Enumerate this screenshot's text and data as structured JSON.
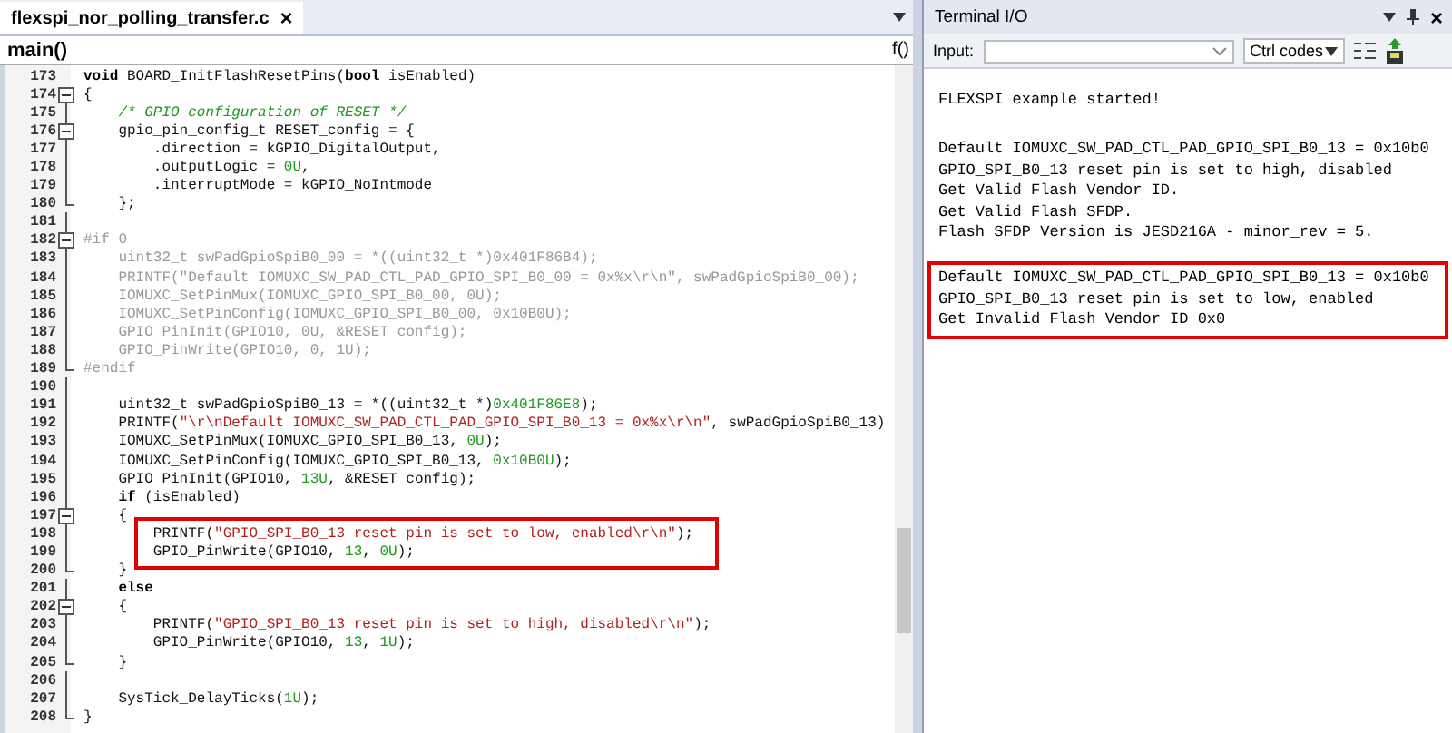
{
  "editor": {
    "tab": {
      "label": "flexspi_nor_polling_transfer.c",
      "close": "×",
      "selected": true
    },
    "function_bar": {
      "label": "main()",
      "button": "f()"
    },
    "lines": [
      {
        "number": "173",
        "kind": "none",
        "highlighted": false,
        "segments": [
          {
            "kind": "keyword",
            "text": "void"
          },
          {
            "kind": "plain",
            "text": " BOARD_InitFlashResetPins("
          },
          {
            "kind": "keyword",
            "text": "bool"
          },
          {
            "kind": "plain",
            "text": " isEnabled)"
          }
        ]
      },
      {
        "number": "174",
        "kind": "open",
        "highlighted": false,
        "segments": [
          {
            "kind": "plain",
            "text": "{"
          }
        ]
      },
      {
        "number": "175",
        "kind": "bar",
        "highlighted": false,
        "segments": [
          {
            "kind": "comment",
            "text": "    /* GPIO configuration of RESET */"
          }
        ]
      },
      {
        "number": "176",
        "kind": "open",
        "highlighted": false,
        "segments": [
          {
            "kind": "plain",
            "text": "    gpio_pin_config_t RESET_config = {"
          }
        ]
      },
      {
        "number": "177",
        "kind": "bar",
        "highlighted": false,
        "segments": [
          {
            "kind": "plain",
            "text": "        .direction = kGPIO_DigitalOutput,"
          }
        ]
      },
      {
        "number": "178",
        "kind": "bar",
        "highlighted": false,
        "segments": [
          {
            "kind": "plain",
            "text": "        .outputLogic = "
          },
          {
            "kind": "number",
            "text": "0U"
          },
          {
            "kind": "plain",
            "text": ","
          }
        ]
      },
      {
        "number": "179",
        "kind": "bar",
        "highlighted": false,
        "segments": [
          {
            "kind": "plain",
            "text": "        .interruptMode = kGPIO_NoIntmode"
          }
        ]
      },
      {
        "number": "180",
        "kind": "end",
        "highlighted": false,
        "segments": [
          {
            "kind": "plain",
            "text": "    };"
          }
        ]
      },
      {
        "number": "181",
        "kind": "bar",
        "highlighted": false
      },
      {
        "number": "182",
        "kind": "open",
        "highlighted": false,
        "segments": [
          {
            "kind": "inactive",
            "text": "#if 0"
          }
        ]
      },
      {
        "number": "183",
        "kind": "bar",
        "highlighted": false,
        "segments": [
          {
            "kind": "inactive",
            "text": "    uint32_t swPadGpioSpiB0_00 = *((uint32_t *)0x401F86B4);"
          }
        ]
      },
      {
        "number": "184",
        "kind": "bar",
        "highlighted": false,
        "segments": [
          {
            "kind": "inactive",
            "text": "    PRINTF(\"Default IOMUXC_SW_PAD_CTL_PAD_GPIO_SPI_B0_00 = 0x%x\\r\\n\", swPadGpioSpiB0_00);"
          }
        ]
      },
      {
        "number": "185",
        "kind": "bar",
        "highlighted": false,
        "segments": [
          {
            "kind": "inactive",
            "text": "    IOMUXC_SetPinMux(IOMUXC_GPIO_SPI_B0_00, 0U);"
          }
        ]
      },
      {
        "number": "186",
        "kind": "bar",
        "highlighted": false,
        "segments": [
          {
            "kind": "inactive",
            "text": "    IOMUXC_SetPinConfig(IOMUXC_GPIO_SPI_B0_00, 0x10B0U);"
          }
        ]
      },
      {
        "number": "187",
        "kind": "bar",
        "highlighted": false,
        "segments": [
          {
            "kind": "inactive",
            "text": "    GPIO_PinInit(GPIO10, 0U, &RESET_config);"
          }
        ]
      },
      {
        "number": "188",
        "kind": "bar",
        "highlighted": false,
        "segments": [
          {
            "kind": "inactive",
            "text": "    GPIO_PinWrite(GPIO10, 0, 1U);"
          }
        ]
      },
      {
        "number": "189",
        "kind": "end",
        "highlighted": false,
        "segments": [
          {
            "kind": "inactive",
            "text": "#endif"
          }
        ]
      },
      {
        "number": "190",
        "kind": "bar",
        "highlighted": false
      },
      {
        "number": "191",
        "kind": "bar",
        "highlighted": false,
        "segments": [
          {
            "kind": "plain",
            "text": "    uint32_t swPadGpioSpiB0_13 = *((uint32_t *)"
          },
          {
            "kind": "number",
            "text": "0x401F86E8"
          },
          {
            "kind": "plain",
            "text": ");"
          }
        ]
      },
      {
        "number": "192",
        "kind": "bar",
        "highlighted": false,
        "segments": [
          {
            "kind": "plain",
            "text": "    PRINTF("
          },
          {
            "kind": "string",
            "text": "\"\\r\\nDefault IOMUXC_SW_PAD_CTL_PAD_GPIO_SPI_B0_13 = 0x%x\\r\\n\""
          },
          {
            "kind": "plain",
            "text": ", swPadGpioSpiB0_13)"
          }
        ]
      },
      {
        "number": "193",
        "kind": "bar",
        "highlighted": false,
        "segments": [
          {
            "kind": "plain",
            "text": "    IOMUXC_SetPinMux(IOMUXC_GPIO_SPI_B0_13, "
          },
          {
            "kind": "number",
            "text": "0U"
          },
          {
            "kind": "plain",
            "text": ");"
          }
        ]
      },
      {
        "number": "194",
        "kind": "bar",
        "highlighted": false,
        "segments": [
          {
            "kind": "plain",
            "text": "    IOMUXC_SetPinConfig(IOMUXC_GPIO_SPI_B0_13, "
          },
          {
            "kind": "number",
            "text": "0x10B0U"
          },
          {
            "kind": "plain",
            "text": ");"
          }
        ]
      },
      {
        "number": "195",
        "kind": "bar",
        "highlighted": false,
        "segments": [
          {
            "kind": "plain",
            "text": "    GPIO_PinInit(GPIO10, "
          },
          {
            "kind": "number",
            "text": "13U"
          },
          {
            "kind": "plain",
            "text": ", &RESET_config);"
          }
        ]
      },
      {
        "number": "196",
        "kind": "bar",
        "highlighted": false,
        "segments": [
          {
            "kind": "keyword",
            "text": "    if"
          },
          {
            "kind": "plain",
            "text": " (isEnabled)"
          }
        ]
      },
      {
        "number": "197",
        "kind": "open",
        "highlighted": false,
        "segments": [
          {
            "kind": "plain",
            "text": "    {"
          }
        ]
      },
      {
        "number": "198",
        "kind": "bar",
        "highlighted": true,
        "segments": [
          {
            "kind": "plain",
            "text": "        PRINTF("
          },
          {
            "kind": "string",
            "text": "\"GPIO_SPI_B0_13 reset pin is set to low, enabled\\r\\n\""
          },
          {
            "kind": "plain",
            "text": ");"
          }
        ]
      },
      {
        "number": "199",
        "kind": "bar",
        "highlighted": true,
        "segments": [
          {
            "kind": "plain",
            "text": "        GPIO_PinWrite(GPIO10, "
          },
          {
            "kind": "number",
            "text": "13"
          },
          {
            "kind": "plain",
            "text": ", "
          },
          {
            "kind": "number",
            "text": "0U"
          },
          {
            "kind": "plain",
            "text": ");"
          }
        ]
      },
      {
        "number": "200",
        "kind": "end",
        "highlighted": false,
        "segments": [
          {
            "kind": "plain",
            "text": "    }"
          }
        ]
      },
      {
        "number": "201",
        "kind": "bar",
        "highlighted": false,
        "segments": [
          {
            "kind": "keyword",
            "text": "    else"
          }
        ]
      },
      {
        "number": "202",
        "kind": "open",
        "highlighted": false,
        "segments": [
          {
            "kind": "plain",
            "text": "    {"
          }
        ]
      },
      {
        "number": "203",
        "kind": "bar",
        "highlighted": false,
        "segments": [
          {
            "kind": "plain",
            "text": "        PRINTF("
          },
          {
            "kind": "string",
            "text": "\"GPIO_SPI_B0_13 reset pin is set to high, disabled\\r\\n\""
          },
          {
            "kind": "plain",
            "text": ");"
          }
        ]
      },
      {
        "number": "204",
        "kind": "bar",
        "highlighted": false,
        "segments": [
          {
            "kind": "plain",
            "text": "        GPIO_PinWrite(GPIO10, "
          },
          {
            "kind": "number",
            "text": "13"
          },
          {
            "kind": "plain",
            "text": ", "
          },
          {
            "kind": "number",
            "text": "1U"
          },
          {
            "kind": "plain",
            "text": ");"
          }
        ]
      },
      {
        "number": "205",
        "kind": "end",
        "highlighted": false,
        "segments": [
          {
            "kind": "plain",
            "text": "    }"
          }
        ]
      },
      {
        "number": "206",
        "kind": "bar",
        "highlighted": false
      },
      {
        "number": "207",
        "kind": "bar",
        "highlighted": false,
        "segments": [
          {
            "kind": "plain",
            "text": "    SysTick_DelayTicks("
          },
          {
            "kind": "number",
            "text": "1U"
          },
          {
            "kind": "plain",
            "text": ");"
          }
        ]
      },
      {
        "number": "208",
        "kind": "end",
        "highlighted": false,
        "segments": [
          {
            "kind": "plain",
            "text": "}"
          }
        ]
      }
    ]
  },
  "terminal": {
    "title": "Terminal I/O",
    "close": "×",
    "input_label": "Input:",
    "ctrl_codes": "Ctrl codes",
    "blocks": [
      {
        "highlighted": false,
        "lines": [
          "FLEXSPI example started!"
        ]
      },
      {
        "highlighted": false,
        "lines": [
          "Default IOMUXC_SW_PAD_CTL_PAD_GPIO_SPI_B0_13 = 0x10b0",
          "GPIO_SPI_B0_13 reset pin is set to high, disabled",
          "Get Valid Flash Vendor ID.",
          "Get Valid Flash SFDP.",
          "Flash SFDP Version is JESD216A - minor_rev = 5."
        ]
      },
      {
        "highlighted": true,
        "lines": [
          "Default IOMUXC_SW_PAD_CTL_PAD_GPIO_SPI_B0_13 = 0x10b0",
          "GPIO_SPI_B0_13 reset pin is set to low, enabled",
          "Get Invalid Flash Vendor ID 0x0"
        ]
      }
    ]
  }
}
